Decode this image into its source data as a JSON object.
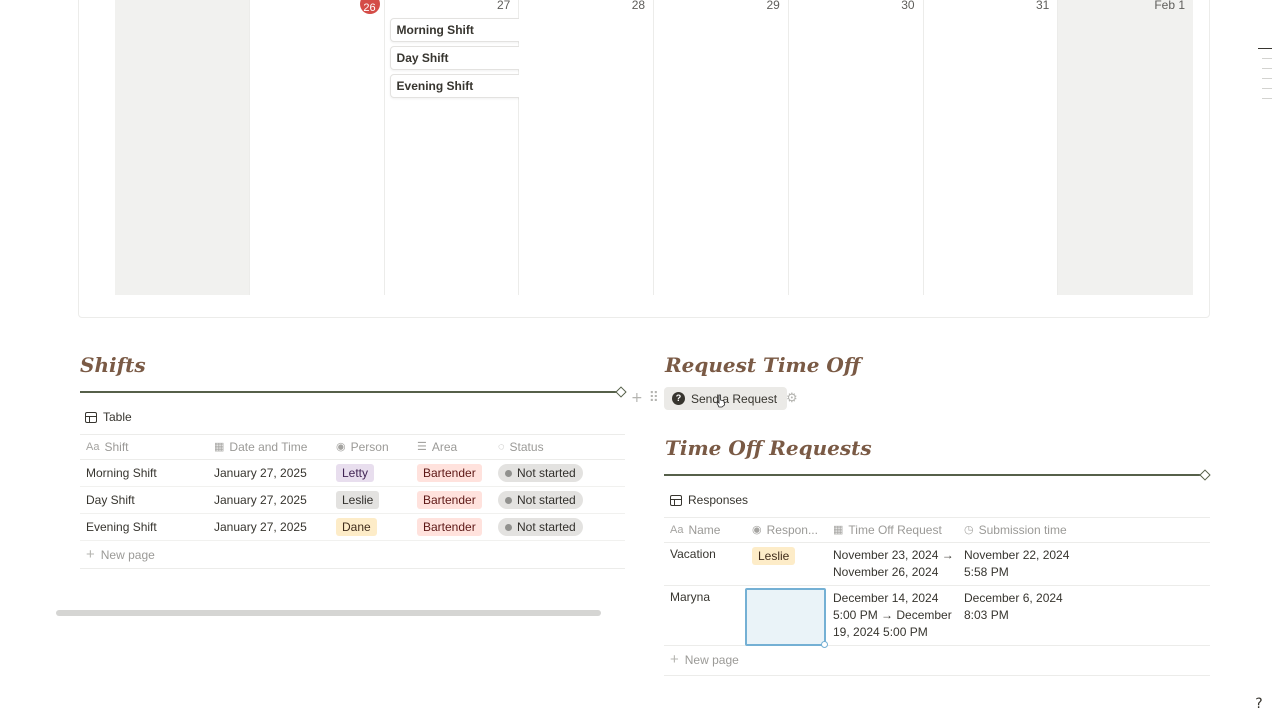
{
  "calendar": {
    "days": [
      {
        "num": "",
        "weekend": true
      },
      {
        "num": "26",
        "today": true,
        "weekend": false
      },
      {
        "num": "27",
        "weekend": false
      },
      {
        "num": "28",
        "weekend": false
      },
      {
        "num": "29",
        "weekend": false
      },
      {
        "num": "30",
        "weekend": false
      },
      {
        "num": "31",
        "weekend": false
      },
      {
        "num": "Feb 1",
        "weekend": true
      }
    ],
    "events_day27": [
      "Morning Shift",
      "Day Shift",
      "Evening Shift"
    ]
  },
  "shifts": {
    "title": "Shifts",
    "view_label": "Table",
    "columns": [
      {
        "icon": "Aa",
        "label": "Shift"
      },
      {
        "icon": "calendar-icon",
        "label": "Date and Time"
      },
      {
        "icon": "person-icon",
        "label": "Person"
      },
      {
        "icon": "list-icon",
        "label": "Area"
      },
      {
        "icon": "status-icon",
        "label": "Status"
      }
    ],
    "rows": [
      {
        "shift": "Morning Shift",
        "date": "January 27, 2025",
        "person": "Letty",
        "person_color": "purple",
        "area": "Bartender",
        "status": "Not started"
      },
      {
        "shift": "Day Shift",
        "date": "January 27, 2025",
        "person": "Leslie",
        "person_color": "gray",
        "area": "Bartender",
        "status": "Not started"
      },
      {
        "shift": "Evening Shift",
        "date": "January 27, 2025",
        "person": "Dane",
        "person_color": "yellow",
        "area": "Bartender",
        "status": "Not started"
      }
    ],
    "new_page": "New page"
  },
  "request": {
    "title": "Request Time Off",
    "button_label": "Send a Request"
  },
  "time_off": {
    "title": "Time Off Requests",
    "view_label": "Responses",
    "columns": [
      {
        "icon": "Aa",
        "label": "Name"
      },
      {
        "icon": "person-icon",
        "label": "Respon..."
      },
      {
        "icon": "calendar-icon",
        "label": "Time Off Request"
      },
      {
        "icon": "clock-icon",
        "label": "Submission time"
      }
    ],
    "rows": [
      {
        "name": "Vacation",
        "responder": "Leslie",
        "request": "November 23, 2024 → November 26, 2024",
        "submitted": "November 22, 2024 5:58 PM"
      },
      {
        "name": "Maryna",
        "responder": "",
        "request": "December 14, 2024 5:00 PM → December 19, 2024 5:00 PM",
        "submitted": "December 6, 2024 8:03 PM"
      }
    ],
    "new_page": "New page"
  },
  "colors": {
    "heading": "#7a5a45",
    "rule": "#56604a",
    "today_badge": "#d44c47"
  }
}
